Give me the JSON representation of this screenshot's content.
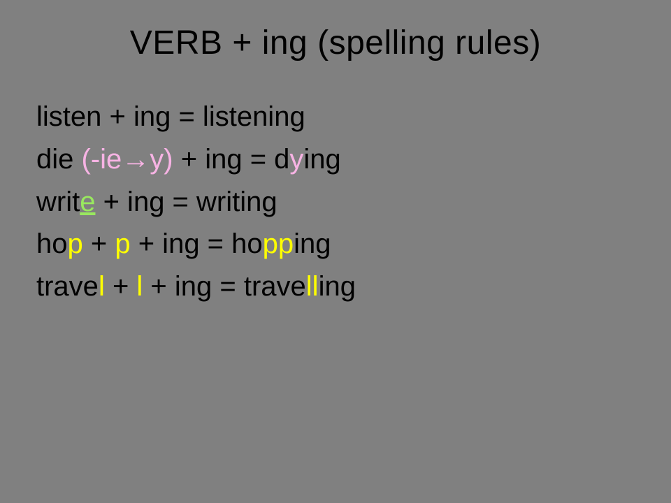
{
  "title": "VERB + ing (spelling rules)",
  "lines": {
    "l1": {
      "t1": "listen + ing = listening"
    },
    "l2": {
      "t1": "die ",
      "p1": "(-ie",
      "arrow": "→",
      "p2": "y)",
      "t2": " + ing = d",
      "y": "y",
      "t3": "ing"
    },
    "l3": {
      "t1": "writ",
      "e": "e",
      "t2": " + ing = writing"
    },
    "l4": {
      "t1": "ho",
      "p1": "p",
      "t2": " + ",
      "p2": "p",
      "t3": " + ing = ho",
      "pp": "pp",
      "t4": "ing"
    },
    "l5": {
      "t1": "trave",
      "l1": "l",
      "t2": " + ",
      "l2": "l",
      "t3": " + ing = trave",
      "ll": "ll",
      "t4": "ing"
    }
  }
}
